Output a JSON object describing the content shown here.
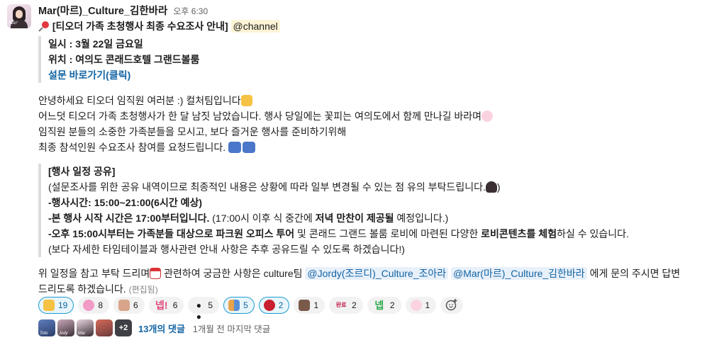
{
  "message": {
    "sender": "Mar(마르)_Culture_김한바라",
    "time": "오후 6:30",
    "avatar_tag": "Mar",
    "title_pin_icon": "pushpin",
    "title": "[티오더 가족 초청행사 최종 수요조사 안내]",
    "channel_mention": "@channel",
    "quote1": {
      "date": "일시 : 3월 22일 금요일",
      "place": "위치 : 여의도 콘래드호텔 그랜드볼룸",
      "survey_link": "설문 바로가기(클릭)"
    },
    "body": [
      "안녕하세요 티오더 임직원 여러분 :) 컬처팀입니다",
      "어느덧 티오더 가족 초청행사가 한 달 남짓 남았습니다. 행사 당일에는 꽃피는 여의도에서 함께 만나길 바라며",
      "임직원 분들의 소중한 가족분들을 모시고, 보다 즐거운 행사를 준비하기위해",
      "최종 참석인원 수요조사 참여를 요청드립니다."
    ],
    "schedule": {
      "heading": "[행사 일정 공유]",
      "note": "(설문조사를 위한 공유 내역이므로 최종적인 내용은 상황에 따라 일부 변경될 수 있는 점 유의 부탁드립니다.",
      "note_end": ")",
      "time_line": "-행사시간: 15:00~21:00(6시간 예상)",
      "start_bold": "-본 행사 시작 시간은  17:00부터입니다.",
      "start_rest1": " (17:00시 이후 식 중간에 ",
      "start_bold2": "저녁 만찬이 제공될",
      "start_rest2": " 예정입니다.)",
      "tour_bold": "-오후 15:00시부터는 가족분들 대상으로 파크원 오피스 투어",
      "tour_rest1": " 및  콘래드 그랜드 볼룸 로비에 마련된 다양한 ",
      "tour_bold2": "로비콘텐츠를 체험",
      "tour_rest2": "하실 수 있습니다.",
      "closing_note": "(보다 자세한 타임테이블과 행사관련 안내 사항은 추후 공유드릴 수 있도록 하겠습니다!)"
    },
    "footer": {
      "part1": "위 일정을 참고 부탁 드리며",
      "part2": " 관련하여 궁금한 사항은 culture팀 ",
      "mention1": "@Jordy(조르디)_Culture_조아라",
      "mention2": "@Mar(마르)_Culture_김한바라",
      "part3": " 에게 문의 주시면 답변",
      "line2": "드리도록 하겠습니다.",
      "edited": "(편집됨)"
    }
  },
  "reactions": [
    {
      "icon": "hand-wave",
      "count": "19",
      "selected": true
    },
    {
      "icon": "pink-pig",
      "count": "8",
      "selected": false
    },
    {
      "icon": "bow",
      "count": "6",
      "selected": false
    },
    {
      "icon": "nep-text",
      "label": "넵!",
      "count": "6",
      "selected": false
    },
    {
      "icon": "eyes",
      "label": "👀",
      "count": "5",
      "selected": false
    },
    {
      "icon": "family",
      "count": "5",
      "selected": true
    },
    {
      "icon": "rose",
      "count": "2",
      "selected": true
    },
    {
      "icon": "portrait",
      "count": "1",
      "selected": false
    },
    {
      "icon": "wanryo-badge",
      "label": "완료",
      "count": "2",
      "selected": false
    },
    {
      "icon": "nep-green",
      "label": "넵",
      "count": "2",
      "selected": false
    },
    {
      "icon": "cherry-blossom",
      "label": "🌸",
      "count": "1",
      "selected": false
    }
  ],
  "replies": {
    "avatars": [
      "Toto",
      "Jody",
      "Mar",
      "",
      ""
    ],
    "more": "+2",
    "count_label": "13개의 댓글",
    "last_reply": "1개월 전 마지막 댓글"
  },
  "colors": {
    "link": "#1264a3",
    "mention_bg": "#fdf4d6",
    "selected_reaction_bg": "#e8f5fa",
    "selected_reaction_border": "#1d9bd1"
  }
}
